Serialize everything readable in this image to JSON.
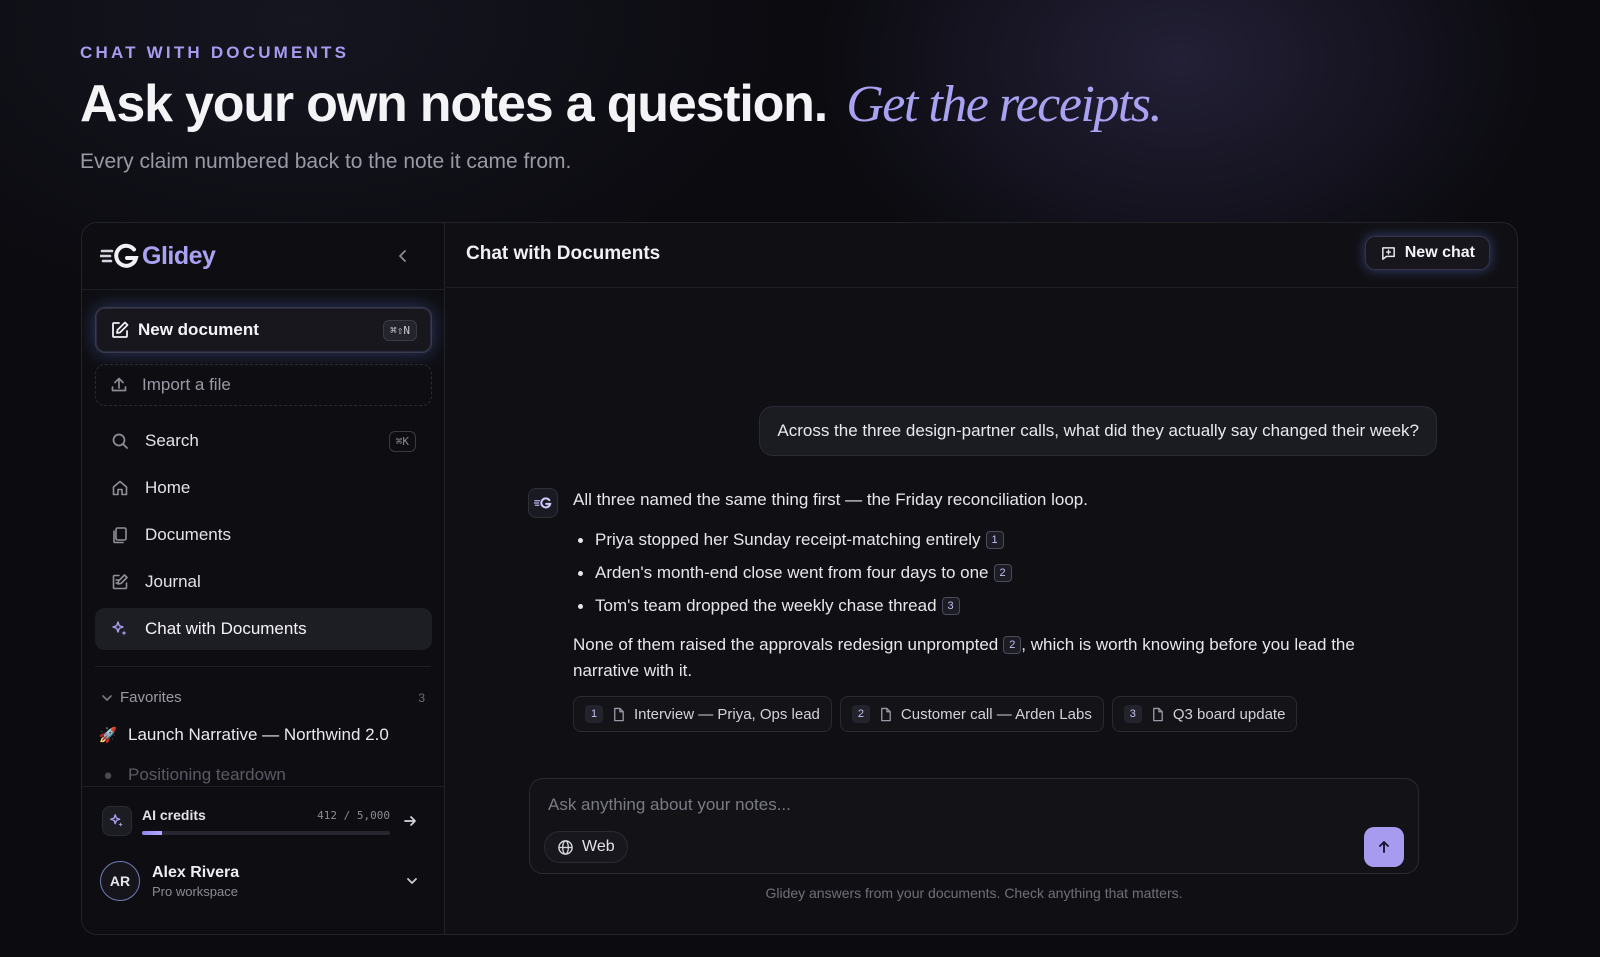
{
  "hero": {
    "eyebrow": "CHAT WITH DOCUMENTS",
    "headline": "Ask your own notes a question.",
    "headline_accent": "Get the receipts.",
    "subhead": "Every claim numbered back to the note it came from."
  },
  "sidebar": {
    "brand": "Glidey",
    "new_document": {
      "label": "New document",
      "shortcut": "⌘⇧N"
    },
    "import": {
      "label": "Import a file"
    },
    "nav": [
      {
        "label": "Search",
        "icon": "search-icon",
        "shortcut": "⌘K"
      },
      {
        "label": "Home",
        "icon": "home-icon"
      },
      {
        "label": "Documents",
        "icon": "documents-icon"
      },
      {
        "label": "Journal",
        "icon": "journal-icon"
      },
      {
        "label": "Chat with Documents",
        "icon": "sparkles-icon",
        "active": true
      }
    ],
    "favorites": {
      "title": "Favorites",
      "count": "3",
      "items": [
        {
          "label": "Launch Narrative — Northwind 2.0",
          "icon": "rocket-icon"
        },
        {
          "label": "Positioning teardown",
          "icon": "document-emoji-icon"
        }
      ]
    },
    "credits": {
      "label": "AI credits",
      "used_display": "412 / 5,000",
      "used_fraction": 0.0824
    },
    "user": {
      "initials": "AR",
      "name": "Alex Rivera",
      "workspace": "Pro workspace"
    }
  },
  "main": {
    "title": "Chat with Documents",
    "new_chat_label": "New chat",
    "user_message": "Across the three design-partner calls, what did they actually say changed their week?",
    "answer": {
      "lead": "All three named the same thing first — the Friday reconciliation loop.",
      "bullets": [
        {
          "text": "Priya stopped her Sunday receipt-matching entirely",
          "cite": "1"
        },
        {
          "text": "Arden's month-end close went from four days to one",
          "cite": "2"
        },
        {
          "text": "Tom's team dropped the weekly chase thread",
          "cite": "3"
        }
      ],
      "para_before": "None of them raised the approvals redesign unprompted",
      "para_cite": "2",
      "para_after": ", which is worth knowing before you lead the narrative with it."
    },
    "sources": [
      {
        "n": "1",
        "label": "Interview — Priya, Ops lead"
      },
      {
        "n": "2",
        "label": "Customer call — Arden Labs"
      },
      {
        "n": "3",
        "label": "Q3 board update"
      }
    ],
    "composer": {
      "placeholder": "Ask anything about your notes...",
      "web_label": "Web"
    },
    "disclaimer": "Glidey answers from your documents. Check anything that matters."
  },
  "colors": {
    "accent": "#a79bf0",
    "background": "#0b0b10",
    "panel": "#101014"
  }
}
